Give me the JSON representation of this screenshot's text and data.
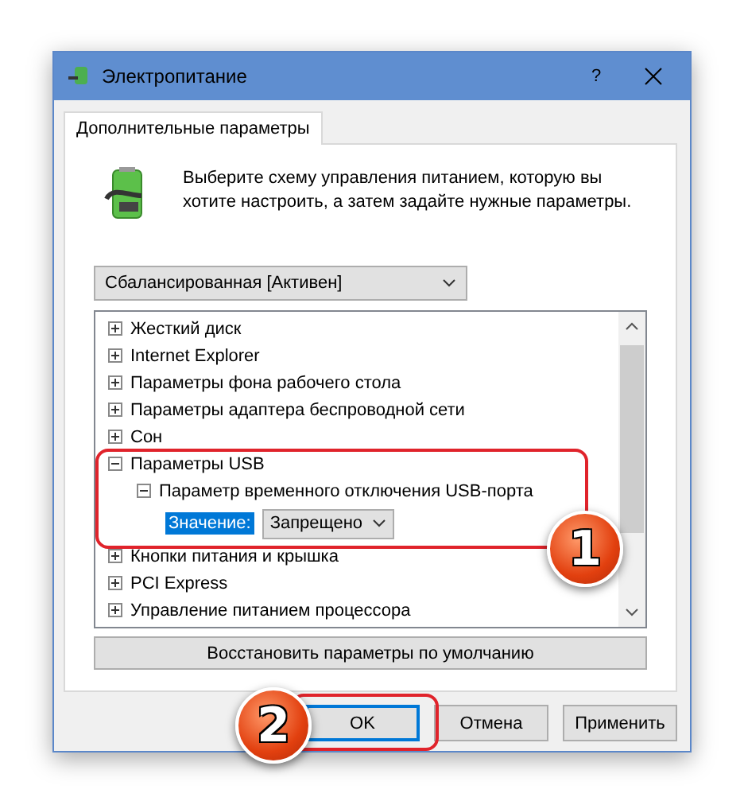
{
  "window": {
    "title": "Электропитание",
    "help_button": "?"
  },
  "tabs": [
    {
      "label": "Дополнительные параметры",
      "selected": true
    }
  ],
  "description": "Выберите схему управления питанием, которую вы хотите настроить, а затем задайте нужные параметры.",
  "scheme_dropdown": {
    "value": "Сбалансированная [Активен]"
  },
  "tree": [
    {
      "label": "Жесткий диск",
      "expanded": false
    },
    {
      "label": "Internet Explorer",
      "expanded": false
    },
    {
      "label": "Параметры фона рабочего стола",
      "expanded": false
    },
    {
      "label": "Параметры адаптера беспроводной сети",
      "expanded": false
    },
    {
      "label": "Сон",
      "expanded": false
    },
    {
      "label": "Параметры USB",
      "expanded": true,
      "children": [
        {
          "label": "Параметр временного отключения USB-порта",
          "expanded": true,
          "setting": {
            "label": "Значение:",
            "value": "Запрещено",
            "selected": true
          }
        }
      ]
    },
    {
      "label": "Кнопки питания и крышка",
      "expanded": false
    },
    {
      "label": "PCI Express",
      "expanded": false
    },
    {
      "label": "Управление питанием процессора",
      "expanded": false
    }
  ],
  "restore_button": "Восстановить параметры по умолчанию",
  "buttons": [
    {
      "label": "OK",
      "focused": true
    },
    {
      "label": "Отмена",
      "focused": false
    },
    {
      "label": "Применить",
      "focused": false
    }
  ],
  "annotations": [
    {
      "number": "1"
    },
    {
      "number": "2"
    }
  ]
}
